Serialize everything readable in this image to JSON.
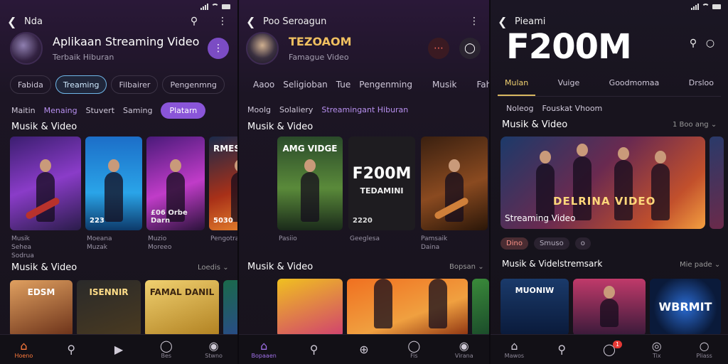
{
  "colors": {
    "accent": "#8a55d8",
    "nav_active": "#ff7a3c",
    "chip_active": "#6fb6e8",
    "tab_active": "#d8b860"
  },
  "panel1": {
    "top_title": "Nda",
    "app_title": "Aplikaan Streaming Video",
    "app_subtitle": "Terbaik Hiburan",
    "chips": [
      "Fabida",
      "Treaming",
      "Filbairer",
      "Pengenmng"
    ],
    "subtabs": [
      "Maitin",
      "Menaing",
      "Stuvert",
      "Saming",
      "Platarn"
    ],
    "section1": "Musik & Video",
    "cards1": [
      {
        "label": "",
        "caption": "Musik Sehea Sodrua"
      },
      {
        "label": "223",
        "caption": "Moeana Muzak"
      },
      {
        "label": "£06 Orbe Darn",
        "caption": "Muzio Moreeo"
      },
      {
        "label": "5030",
        "title": "RMESESRM",
        "caption": "Pengotramiser"
      }
    ],
    "section2": "Musik & Video",
    "more": "Loedis",
    "cards2": [
      {
        "title": "EDSM"
      },
      {
        "title": "ISENNIR"
      },
      {
        "title": "FAMAL DANIL"
      },
      {
        "title": ""
      }
    ],
    "nav": [
      {
        "label": "Hoeno",
        "icon": "home-icon"
      },
      {
        "label": "",
        "icon": "search-icon"
      },
      {
        "label": "",
        "icon": "play-icon"
      },
      {
        "label": "Bes",
        "icon": "chat-icon"
      },
      {
        "label": "Stwno",
        "icon": "profile-icon"
      }
    ]
  },
  "panel2": {
    "top_title": "Poo Seroagun",
    "app_title": "TEZOAOM",
    "app_subtitle": "Famague Video",
    "chips": [
      "Aaoo",
      "Seligioban",
      "Tue",
      "Pengenming",
      "Musik",
      "Fahe"
    ],
    "subtabs": [
      "Moolg",
      "Solaliery",
      "Streamingant Hiburan"
    ],
    "section1": "Musik & Video",
    "cards1": [
      {
        "title": "AMG VIDGE",
        "label": "",
        "caption": "Pasiio"
      },
      {
        "title": "F200M",
        "sub": "TEDAMINI",
        "label": "2220",
        "caption": "Geeglesa"
      },
      {
        "title": "",
        "label": "",
        "caption": "Pamsaik Daina"
      }
    ],
    "section2": "Musik & Video",
    "more": "Bopsan",
    "nav": [
      {
        "label": "Bopaaen",
        "icon": "home-icon"
      },
      {
        "label": "",
        "icon": "search-icon"
      },
      {
        "label": "",
        "icon": "add-icon"
      },
      {
        "label": "Fis",
        "icon": "chat-icon"
      },
      {
        "label": "Virana",
        "icon": "profile-icon"
      }
    ]
  },
  "panel3": {
    "top_title": "Pieami",
    "big_title": "F200M",
    "tabs": [
      "Mulan",
      "Vuige",
      "Goodmomaa",
      "Drsloo"
    ],
    "subtabs": [
      "Noleog",
      "Fouskat Vhoom"
    ],
    "section1": "Musik & Video",
    "more": "1 Boo ang",
    "hero_title": "DELRINA VIDEO",
    "hero_sub": "Streaming Video",
    "dots": [
      "Dino",
      "Smuso",
      "o"
    ],
    "section2": "Musik & Videlstremsark",
    "more2": "Mie pade",
    "cards2": [
      {
        "title": "MUONIW"
      },
      {
        "title": ""
      },
      {
        "title": "WBRMIT"
      }
    ],
    "badge": "1",
    "nav": [
      {
        "label": "Mawos",
        "icon": "home-icon"
      },
      {
        "label": "",
        "icon": "search-icon"
      },
      {
        "label": "",
        "icon": "notification-icon"
      },
      {
        "label": "Tix",
        "icon": "chat-icon"
      },
      {
        "label": "Pliass",
        "icon": "profile-icon"
      }
    ]
  }
}
